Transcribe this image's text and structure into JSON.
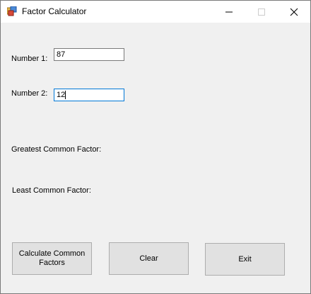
{
  "window": {
    "title": "Factor Calculator",
    "icon": "form-app-icon",
    "controls": [
      "minimize-icon",
      "maximize-icon",
      "close-icon"
    ]
  },
  "form": {
    "number1_label": "Number 1:",
    "number1_value": "87",
    "number2_label": "Number 2:",
    "number2_value": "12",
    "gcf_label": "Greatest Common Factor:",
    "lcf_label": "Least Common Factor:"
  },
  "buttons": {
    "calculate_label": "Calculate Common Factors",
    "clear_label": "Clear",
    "exit_label": "Exit"
  },
  "colors": {
    "window_bg": "#f0f0f0",
    "focus_border": "#0078d7",
    "button_bg": "#e1e1e1"
  }
}
